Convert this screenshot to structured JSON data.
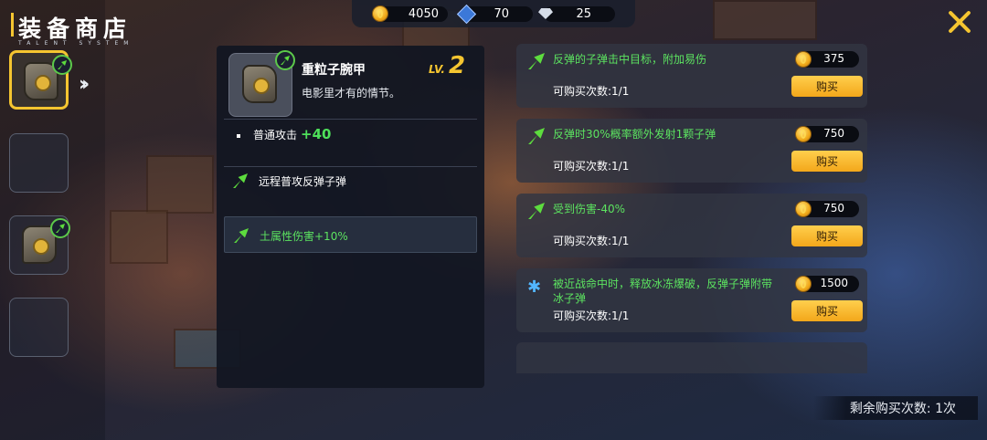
{
  "header": {
    "title": "装备商店",
    "subtitle": "TALENT SYSTEM"
  },
  "currency": [
    {
      "icon": "gold-coin-icon",
      "value": "4050"
    },
    {
      "icon": "blue-gem-icon",
      "value": "70"
    },
    {
      "icon": "diamond-icon",
      "value": "25"
    }
  ],
  "detail": {
    "name": "重粒子腕甲",
    "description": "电影里才有的情节。",
    "level_prefix": "LV.",
    "level": "2",
    "stat_label": "普通攻击",
    "stat_value": "+40",
    "perks": [
      {
        "text": "远程普攻反弹子弹",
        "highlighted": false
      },
      {
        "text": "土属性伤害+10%",
        "highlighted": true
      }
    ]
  },
  "shop": {
    "buy_label": "购买",
    "items": [
      {
        "text": "反弹的子弹击中目标，附加易伤",
        "count": "可购买次数:1/1",
        "price": "375",
        "icon": "arrow-upgrade-icon"
      },
      {
        "text": "反弹时30%概率额外发射1颗子弹",
        "count": "可购买次数:1/1",
        "price": "750",
        "icon": "arrow-upgrade-icon"
      },
      {
        "text": "受到伤害-40%",
        "count": "可购买次数:1/1",
        "price": "750",
        "icon": "arrow-upgrade-icon"
      },
      {
        "text": "被近战命中时，释放冰冻爆破，反弹子弹附带冰子弹",
        "count": "可购买次数:1/1",
        "price": "1500",
        "icon": "snowflake-icon"
      }
    ]
  },
  "footer": {
    "remaining": "剩余购买次数: 1次"
  },
  "colors": {
    "accent": "#f5c530",
    "green": "#5ce360",
    "buy_button": "#f8bb2c"
  }
}
